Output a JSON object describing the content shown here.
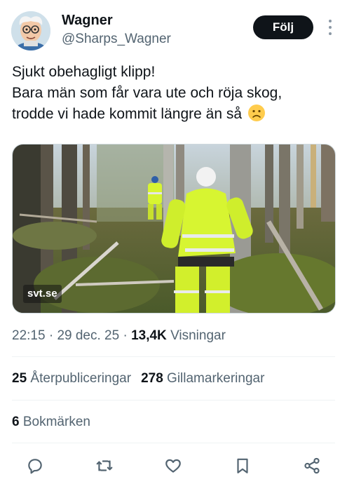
{
  "author": {
    "name": "Wagner",
    "handle": "@Sharps_Wagner",
    "avatar_icon": "cartoon-avatar"
  },
  "follow_label": "Följ",
  "post": {
    "lines": [
      "Sjukt obehagligt klipp!",
      "Bara män som får vara ute och röja skog,",
      "trodde vi hade kommit längre än så"
    ],
    "emoji": "frowning-face-icon"
  },
  "media": {
    "watermark": "svt.se"
  },
  "meta": {
    "time": "22:15",
    "dot1": "·",
    "date": "29 dec. 25",
    "dot2": "·",
    "views_count": "13,4K",
    "views_label": "Visningar"
  },
  "stats": {
    "reposts_count": "25",
    "reposts_label": "Återpubliceringar",
    "likes_count": "278",
    "likes_label": "Gillamarkeringar",
    "bookmarks_count": "6",
    "bookmarks_label": "Bokmärken"
  },
  "actions": [
    "reply-icon",
    "repost-icon",
    "like-icon",
    "bookmark-icon",
    "share-icon"
  ],
  "colors": {
    "text": "#0f1419",
    "secondary": "#536471",
    "follow_bg": "#0f1419",
    "divider": "#eff3f4",
    "hi_vis": "#d7f531"
  }
}
